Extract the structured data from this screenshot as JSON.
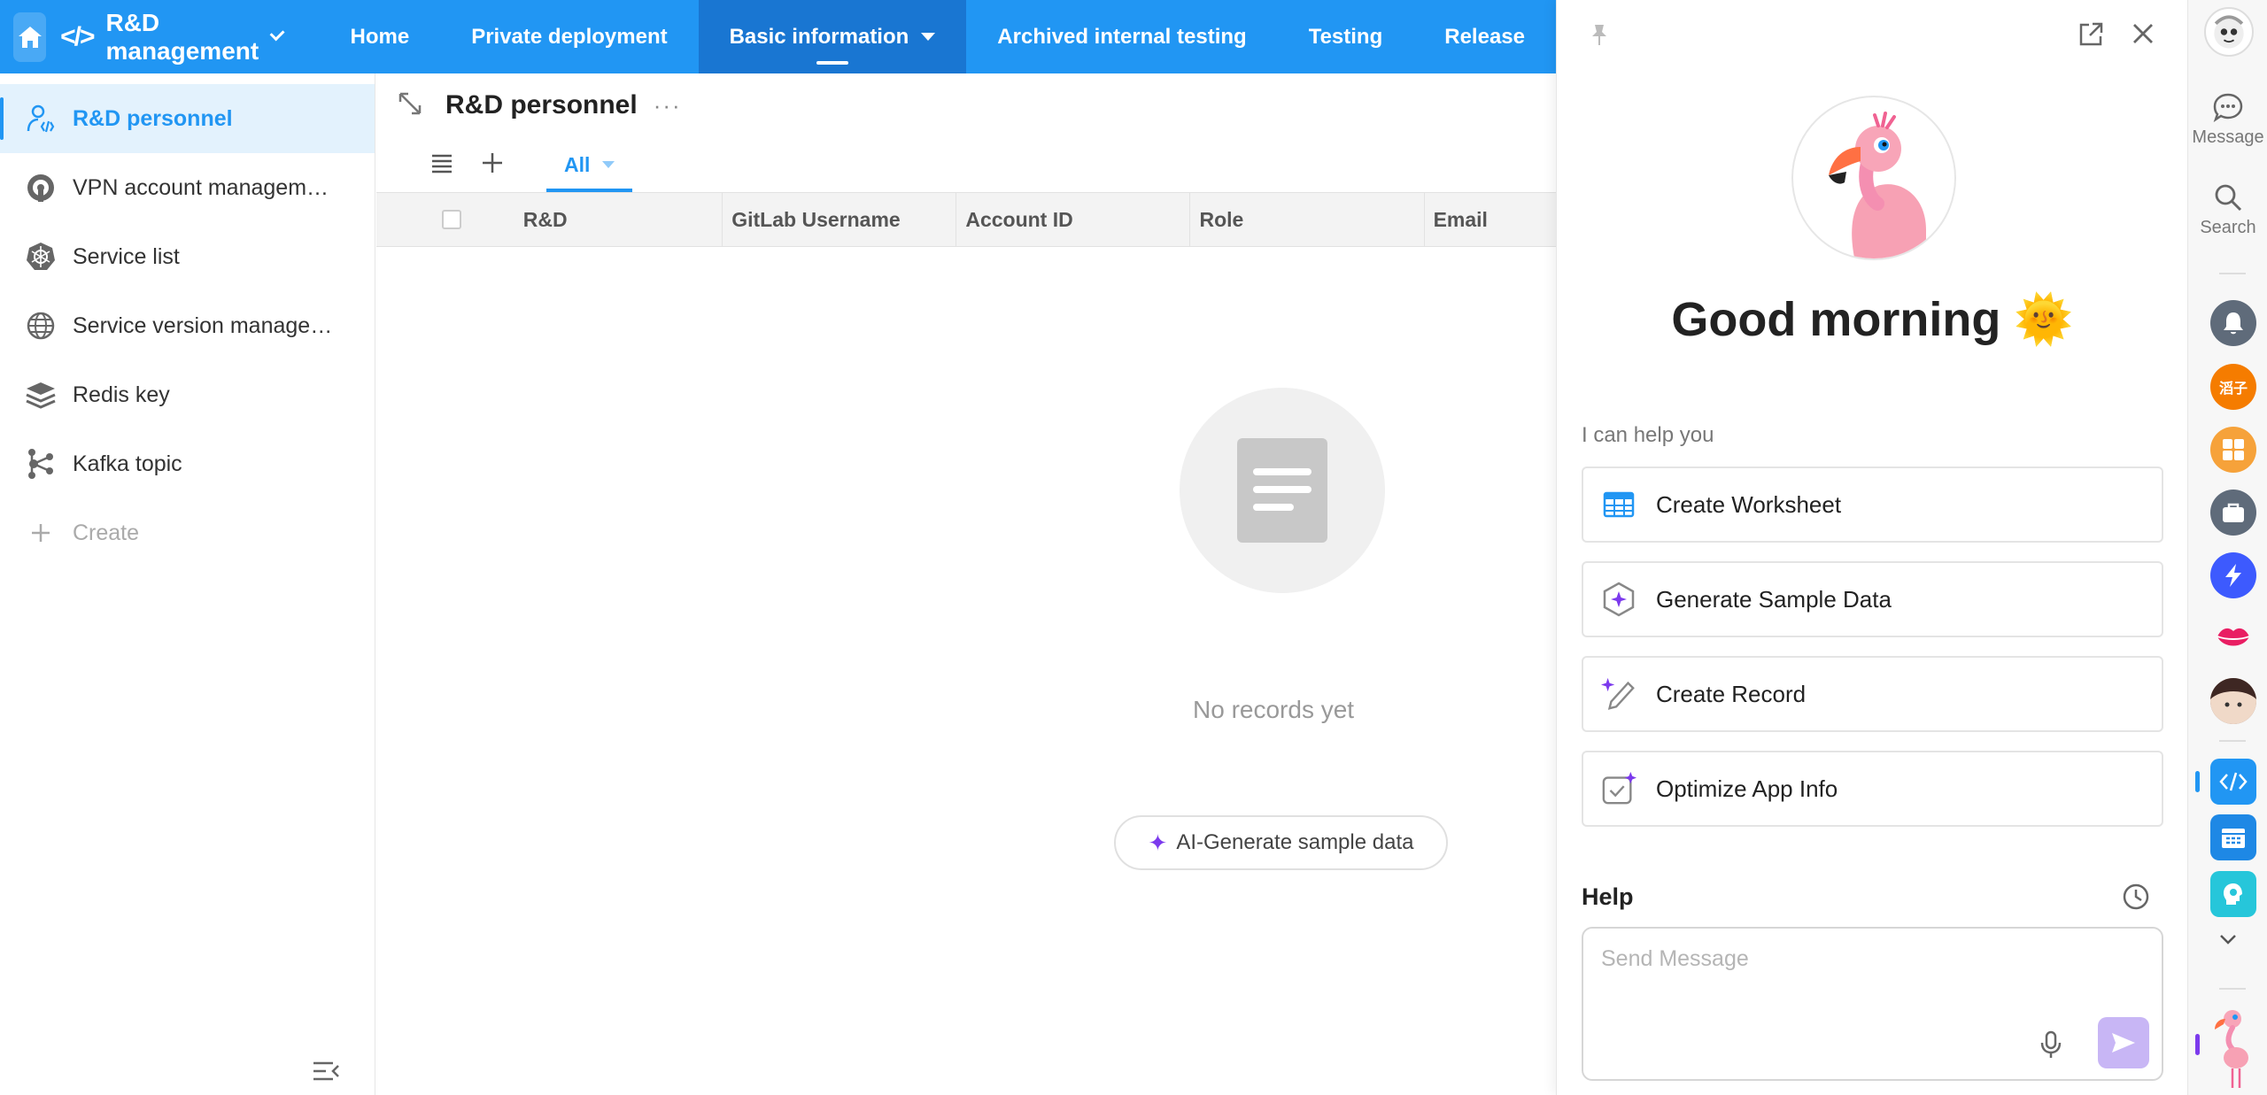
{
  "topbar": {
    "app_icon": "</>",
    "app_title": "R&D management",
    "nav": [
      {
        "label": "Home"
      },
      {
        "label": "Private deployment"
      },
      {
        "label": "Basic information"
      },
      {
        "label": "Archived internal testing"
      },
      {
        "label": "Testing"
      },
      {
        "label": "Release"
      }
    ],
    "accent": "#2196F3",
    "active_bg": "#1976D2"
  },
  "sidebar": {
    "items": [
      {
        "label": "R&D personnel",
        "icon": "developer-icon"
      },
      {
        "label": "VPN account managem…",
        "icon": "vpn-icon"
      },
      {
        "label": "Service list",
        "icon": "kubernetes-icon"
      },
      {
        "label": "Service version manage…",
        "icon": "globe-icon"
      },
      {
        "label": "Redis key",
        "icon": "layers-icon"
      },
      {
        "label": "Kafka topic",
        "icon": "kafka-icon"
      }
    ],
    "create_label": "Create"
  },
  "main": {
    "title": "R&D personnel",
    "view_tab": "All",
    "columns": [
      "R&D",
      "GitLab Username",
      "Account ID",
      "Role",
      "Email"
    ],
    "empty_text": "No records yet",
    "ai_generate_label": "AI-Generate sample data"
  },
  "assistant": {
    "greeting": "Good morning",
    "greeting_emoji": "🌞",
    "help_you": "I can help you",
    "suggestions": [
      {
        "label": "Create Worksheet",
        "icon": "worksheet-icon"
      },
      {
        "label": "Generate Sample Data",
        "icon": "sample-data-icon"
      },
      {
        "label": "Create Record",
        "icon": "create-record-icon"
      },
      {
        "label": "Optimize App Info",
        "icon": "optimize-icon"
      }
    ],
    "help_label": "Help",
    "message_placeholder": "Send Message"
  },
  "rail": {
    "message_label": "Message",
    "search_label": "Search",
    "chip_text": "滔子"
  }
}
